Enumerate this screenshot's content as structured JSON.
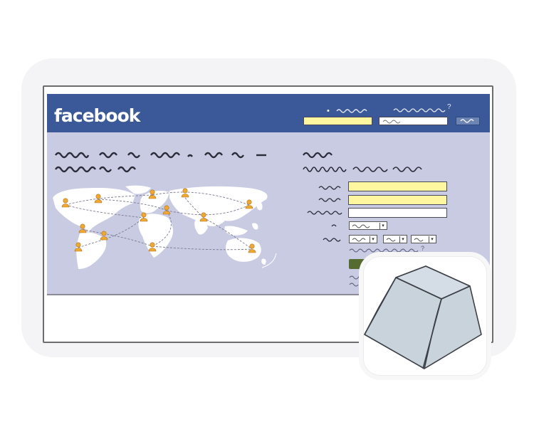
{
  "header": {
    "logo_text": "facebook",
    "login_marks": [
      "•",
      "?"
    ]
  },
  "signup": {
    "help_mark": "?"
  },
  "colors": {
    "brand_blue": "#3b5998",
    "content_bg": "#c9cbe3",
    "input_yellow": "#fff7a0",
    "pin_orange": "#f0a830",
    "submit_green": "#556b2f",
    "key_gray": "#c9d3dc"
  },
  "icons": {
    "world_map": "world-map-icon",
    "person_pin": "person-pin-icon",
    "keyboard_key": "keyboard-key-icon"
  }
}
